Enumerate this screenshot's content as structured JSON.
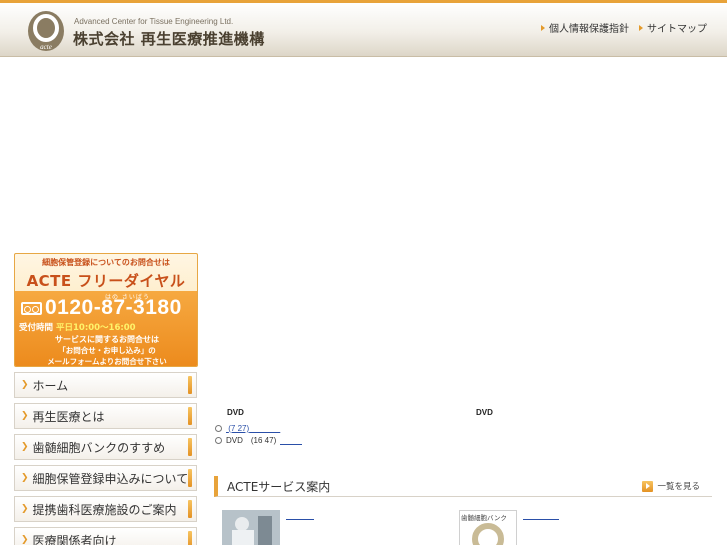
{
  "header": {
    "company_en": "Advanced Center for Tissue Engineering Ltd.",
    "company_jp": "株式会社 再生医療推進機構",
    "logo_text": "acte",
    "links": [
      "個人情報保護指針",
      "サイトマップ"
    ]
  },
  "dial_banner": {
    "top_line": "細胞保管登録についてのお問合せは",
    "title": "ACTE フリーダイヤル",
    "kana": "はの さいばう",
    "number": "0120-87-3180",
    "hours_label": "受付時間",
    "hours_value": "平日10:00〜16:00",
    "line1": "サービスに関するお問合せは",
    "line2": "「お問合せ・お申し込み」の",
    "line3": "メールフォームよりお問合せ下さい"
  },
  "nav": {
    "items": [
      {
        "label": "ホーム"
      },
      {
        "label": "再生医療とは"
      },
      {
        "label": "歯髄細胞バンクのすすめ"
      },
      {
        "label": "細胞保管登録申込みについて"
      },
      {
        "label": "提携歯科医療施設のご案内"
      },
      {
        "label": "医療関係者向け"
      }
    ]
  },
  "dvd": {
    "left_heading": "DVD",
    "right_heading": "DVD",
    "row1_link": "(7 27)",
    "row2_label": "DVD",
    "row2_detail": "(16 47)"
  },
  "services": {
    "title": "ACTEサービス案内",
    "see_all": "一覧を見る",
    "thumb2_label": "歯髄細胞バンク"
  },
  "colors": {
    "accent": "#e8a33a",
    "brand_orange": "#ec8a1c",
    "link": "#2a4fa8"
  }
}
